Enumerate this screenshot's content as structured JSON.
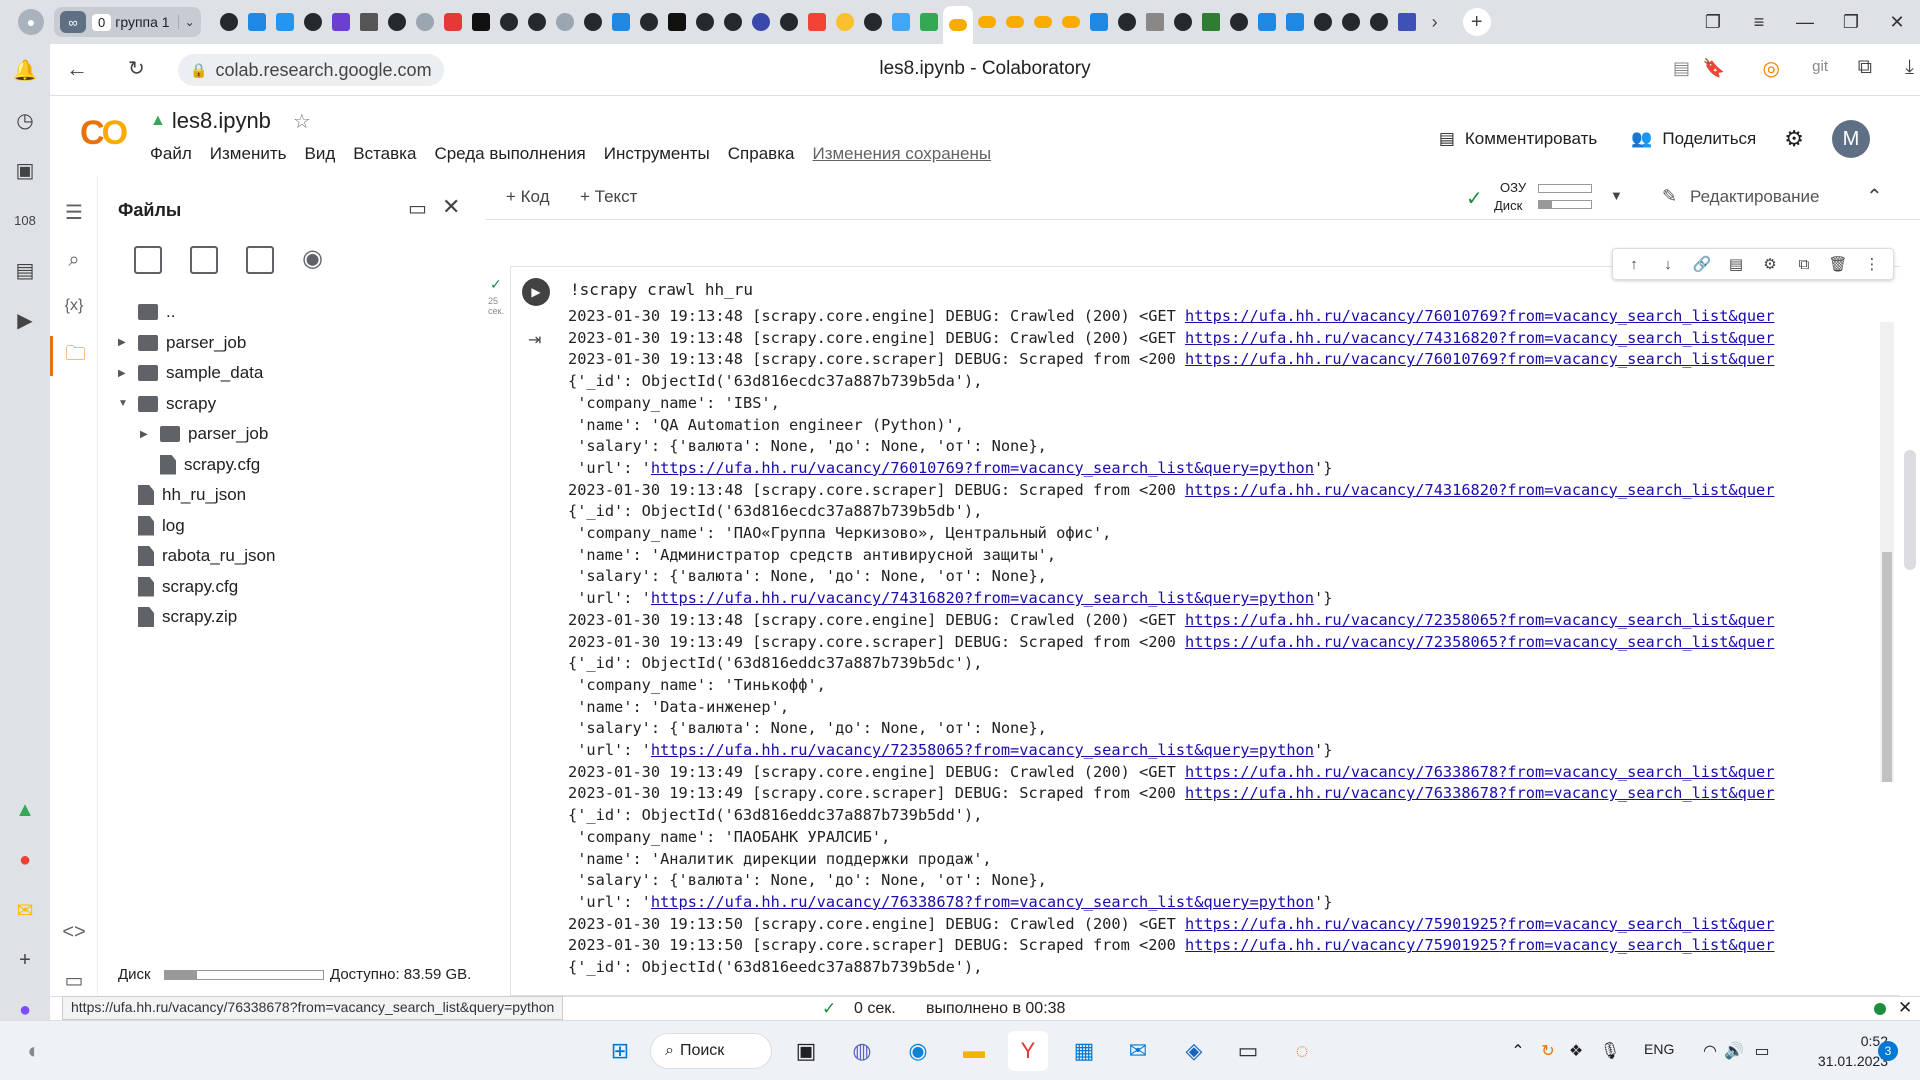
{
  "browser": {
    "tab_group": {
      "count": "0",
      "label": "группа 1"
    },
    "url": "colab.research.google.com",
    "page_title": "les8.ipynb - Colaboratory"
  },
  "colab": {
    "logo": "CO",
    "notebook_name": "les8.ipynb",
    "menu": [
      "Файл",
      "Изменить",
      "Вид",
      "Вставка",
      "Среда выполнения",
      "Инструменты",
      "Справка"
    ],
    "saved_status": "Изменения сохранены",
    "comment_label": "Комментировать",
    "share_label": "Поделиться",
    "user_initial": "M"
  },
  "files_panel": {
    "title": "Файлы",
    "tree": [
      {
        "name": "..",
        "type": "folder-up",
        "level": 0,
        "caret": ""
      },
      {
        "name": "parser_job",
        "type": "folder",
        "level": 0,
        "caret": "▶"
      },
      {
        "name": "sample_data",
        "type": "folder",
        "level": 0,
        "caret": "▶"
      },
      {
        "name": "scrapy",
        "type": "folder",
        "level": 0,
        "caret": "▼"
      },
      {
        "name": "parser_job",
        "type": "folder",
        "level": 1,
        "caret": "▶"
      },
      {
        "name": "scrapy.cfg",
        "type": "file",
        "level": 1,
        "caret": ""
      },
      {
        "name": "hh_ru_json",
        "type": "file",
        "level": 0,
        "caret": ""
      },
      {
        "name": "log",
        "type": "file",
        "level": 0,
        "caret": ""
      },
      {
        "name": "rabota_ru_json",
        "type": "file",
        "level": 0,
        "caret": ""
      },
      {
        "name": "scrapy.cfg",
        "type": "file",
        "level": 0,
        "caret": ""
      },
      {
        "name": "scrapy.zip",
        "type": "file",
        "level": 0,
        "caret": ""
      }
    ],
    "disk_label": "Диск",
    "disk_used_fraction": 0.2,
    "available": "Доступно: 83.59 GB."
  },
  "toolbar": {
    "add_code": "+ Код",
    "add_text": "+ Текст",
    "ram_label": "ОЗУ",
    "disk_label": "Диск",
    "editing": "Редактирование"
  },
  "cell": {
    "exec_time": "25 сек.",
    "code": "!scrapy crawl hh_ru",
    "output_lines": [
      {
        "t": "2023-01-30 19:13:48 [scrapy.core.engine] DEBUG: Crawled (200) <GET ",
        "l": "https://ufa.hh.ru/vacancy/76010769?from=vacancy_search_list&quer"
      },
      {
        "t": "2023-01-30 19:13:48 [scrapy.core.engine] DEBUG: Crawled (200) <GET ",
        "l": "https://ufa.hh.ru/vacancy/74316820?from=vacancy_search_list&quer"
      },
      {
        "t": "2023-01-30 19:13:48 [scrapy.core.scraper] DEBUG: Scraped from <200 ",
        "l": "https://ufa.hh.ru/vacancy/76010769?from=vacancy_search_list&quer"
      },
      {
        "t": "{'_id': ObjectId('63d816ecdc37a887b739b5da'),",
        "l": ""
      },
      {
        "t": " 'company_name': 'IBS',",
        "l": ""
      },
      {
        "t": " 'name': 'QA Automation engineer (Python)',",
        "l": ""
      },
      {
        "t": " 'salary': {'валюта': None, 'до': None, 'от': None},",
        "l": ""
      },
      {
        "t": " 'url': '",
        "l": "https://ufa.hh.ru/vacancy/76010769?from=vacancy_search_list&query=python",
        "e": "'}"
      },
      {
        "t": "2023-01-30 19:13:48 [scrapy.core.scraper] DEBUG: Scraped from <200 ",
        "l": "https://ufa.hh.ru/vacancy/74316820?from=vacancy_search_list&quer"
      },
      {
        "t": "{'_id': ObjectId('63d816ecdc37a887b739b5db'),",
        "l": ""
      },
      {
        "t": " 'company_name': 'ПАО«Группа Черкизово», Центральный офис',",
        "l": ""
      },
      {
        "t": " 'name': 'Администратор средств антивирусной защиты',",
        "l": ""
      },
      {
        "t": " 'salary': {'валюта': None, 'до': None, 'от': None},",
        "l": ""
      },
      {
        "t": " 'url': '",
        "l": "https://ufa.hh.ru/vacancy/74316820?from=vacancy_search_list&query=python",
        "e": "'}"
      },
      {
        "t": "2023-01-30 19:13:48 [scrapy.core.engine] DEBUG: Crawled (200) <GET ",
        "l": "https://ufa.hh.ru/vacancy/72358065?from=vacancy_search_list&quer"
      },
      {
        "t": "2023-01-30 19:13:49 [scrapy.core.scraper] DEBUG: Scraped from <200 ",
        "l": "https://ufa.hh.ru/vacancy/72358065?from=vacancy_search_list&quer"
      },
      {
        "t": "{'_id': ObjectId('63d816eddc37a887b739b5dc'),",
        "l": ""
      },
      {
        "t": " 'company_name': 'Тинькофф',",
        "l": ""
      },
      {
        "t": " 'name': 'Data-инженер',",
        "l": ""
      },
      {
        "t": " 'salary': {'валюта': None, 'до': None, 'от': None},",
        "l": ""
      },
      {
        "t": " 'url': '",
        "l": "https://ufa.hh.ru/vacancy/72358065?from=vacancy_search_list&query=python",
        "e": "'}"
      },
      {
        "t": "2023-01-30 19:13:49 [scrapy.core.engine] DEBUG: Crawled (200) <GET ",
        "l": "https://ufa.hh.ru/vacancy/76338678?from=vacancy_search_list&quer"
      },
      {
        "t": "2023-01-30 19:13:49 [scrapy.core.scraper] DEBUG: Scraped from <200 ",
        "l": "https://ufa.hh.ru/vacancy/76338678?from=vacancy_search_list&quer"
      },
      {
        "t": "{'_id': ObjectId('63d816eddc37a887b739b5dd'),",
        "l": ""
      },
      {
        "t": " 'company_name': 'ПАОБАНК УРАЛСИБ',",
        "l": ""
      },
      {
        "t": " 'name': 'Аналитик дирекции поддержки продаж',",
        "l": ""
      },
      {
        "t": " 'salary': {'валюта': None, 'до': None, 'от': None},",
        "l": ""
      },
      {
        "t": " 'url': '",
        "l": "https://ufa.hh.ru/vacancy/76338678?from=vacancy_search_list&query=python",
        "e": "'}"
      },
      {
        "t": "2023-01-30 19:13:50 [scrapy.core.engine] DEBUG: Crawled (200) <GET ",
        "l": "https://ufa.hh.ru/vacancy/75901925?from=vacancy_search_list&quer"
      },
      {
        "t": "2023-01-30 19:13:50 [scrapy.core.scraper] DEBUG: Scraped from <200 ",
        "l": "https://ufa.hh.ru/vacancy/75901925?from=vacancy_search_list&quer"
      },
      {
        "t": "{'_id': ObjectId('63d816eedc37a887b739b5de'),",
        "l": ""
      }
    ]
  },
  "status": {
    "hover_url": "https://ufa.hh.ru/vacancy/76338678?from=vacancy_search_list&query=python",
    "exec": "0 сек.",
    "completed": "выполнено в 00:38"
  },
  "taskbar": {
    "search": "Поиск",
    "lang": "ENG",
    "time": "0:52",
    "date": "31.01.2023",
    "notif": "3"
  },
  "colors": {
    "colab_orange": "#f9ab00",
    "link": "#1a0dab",
    "ok_green": "#1e8e3e"
  }
}
